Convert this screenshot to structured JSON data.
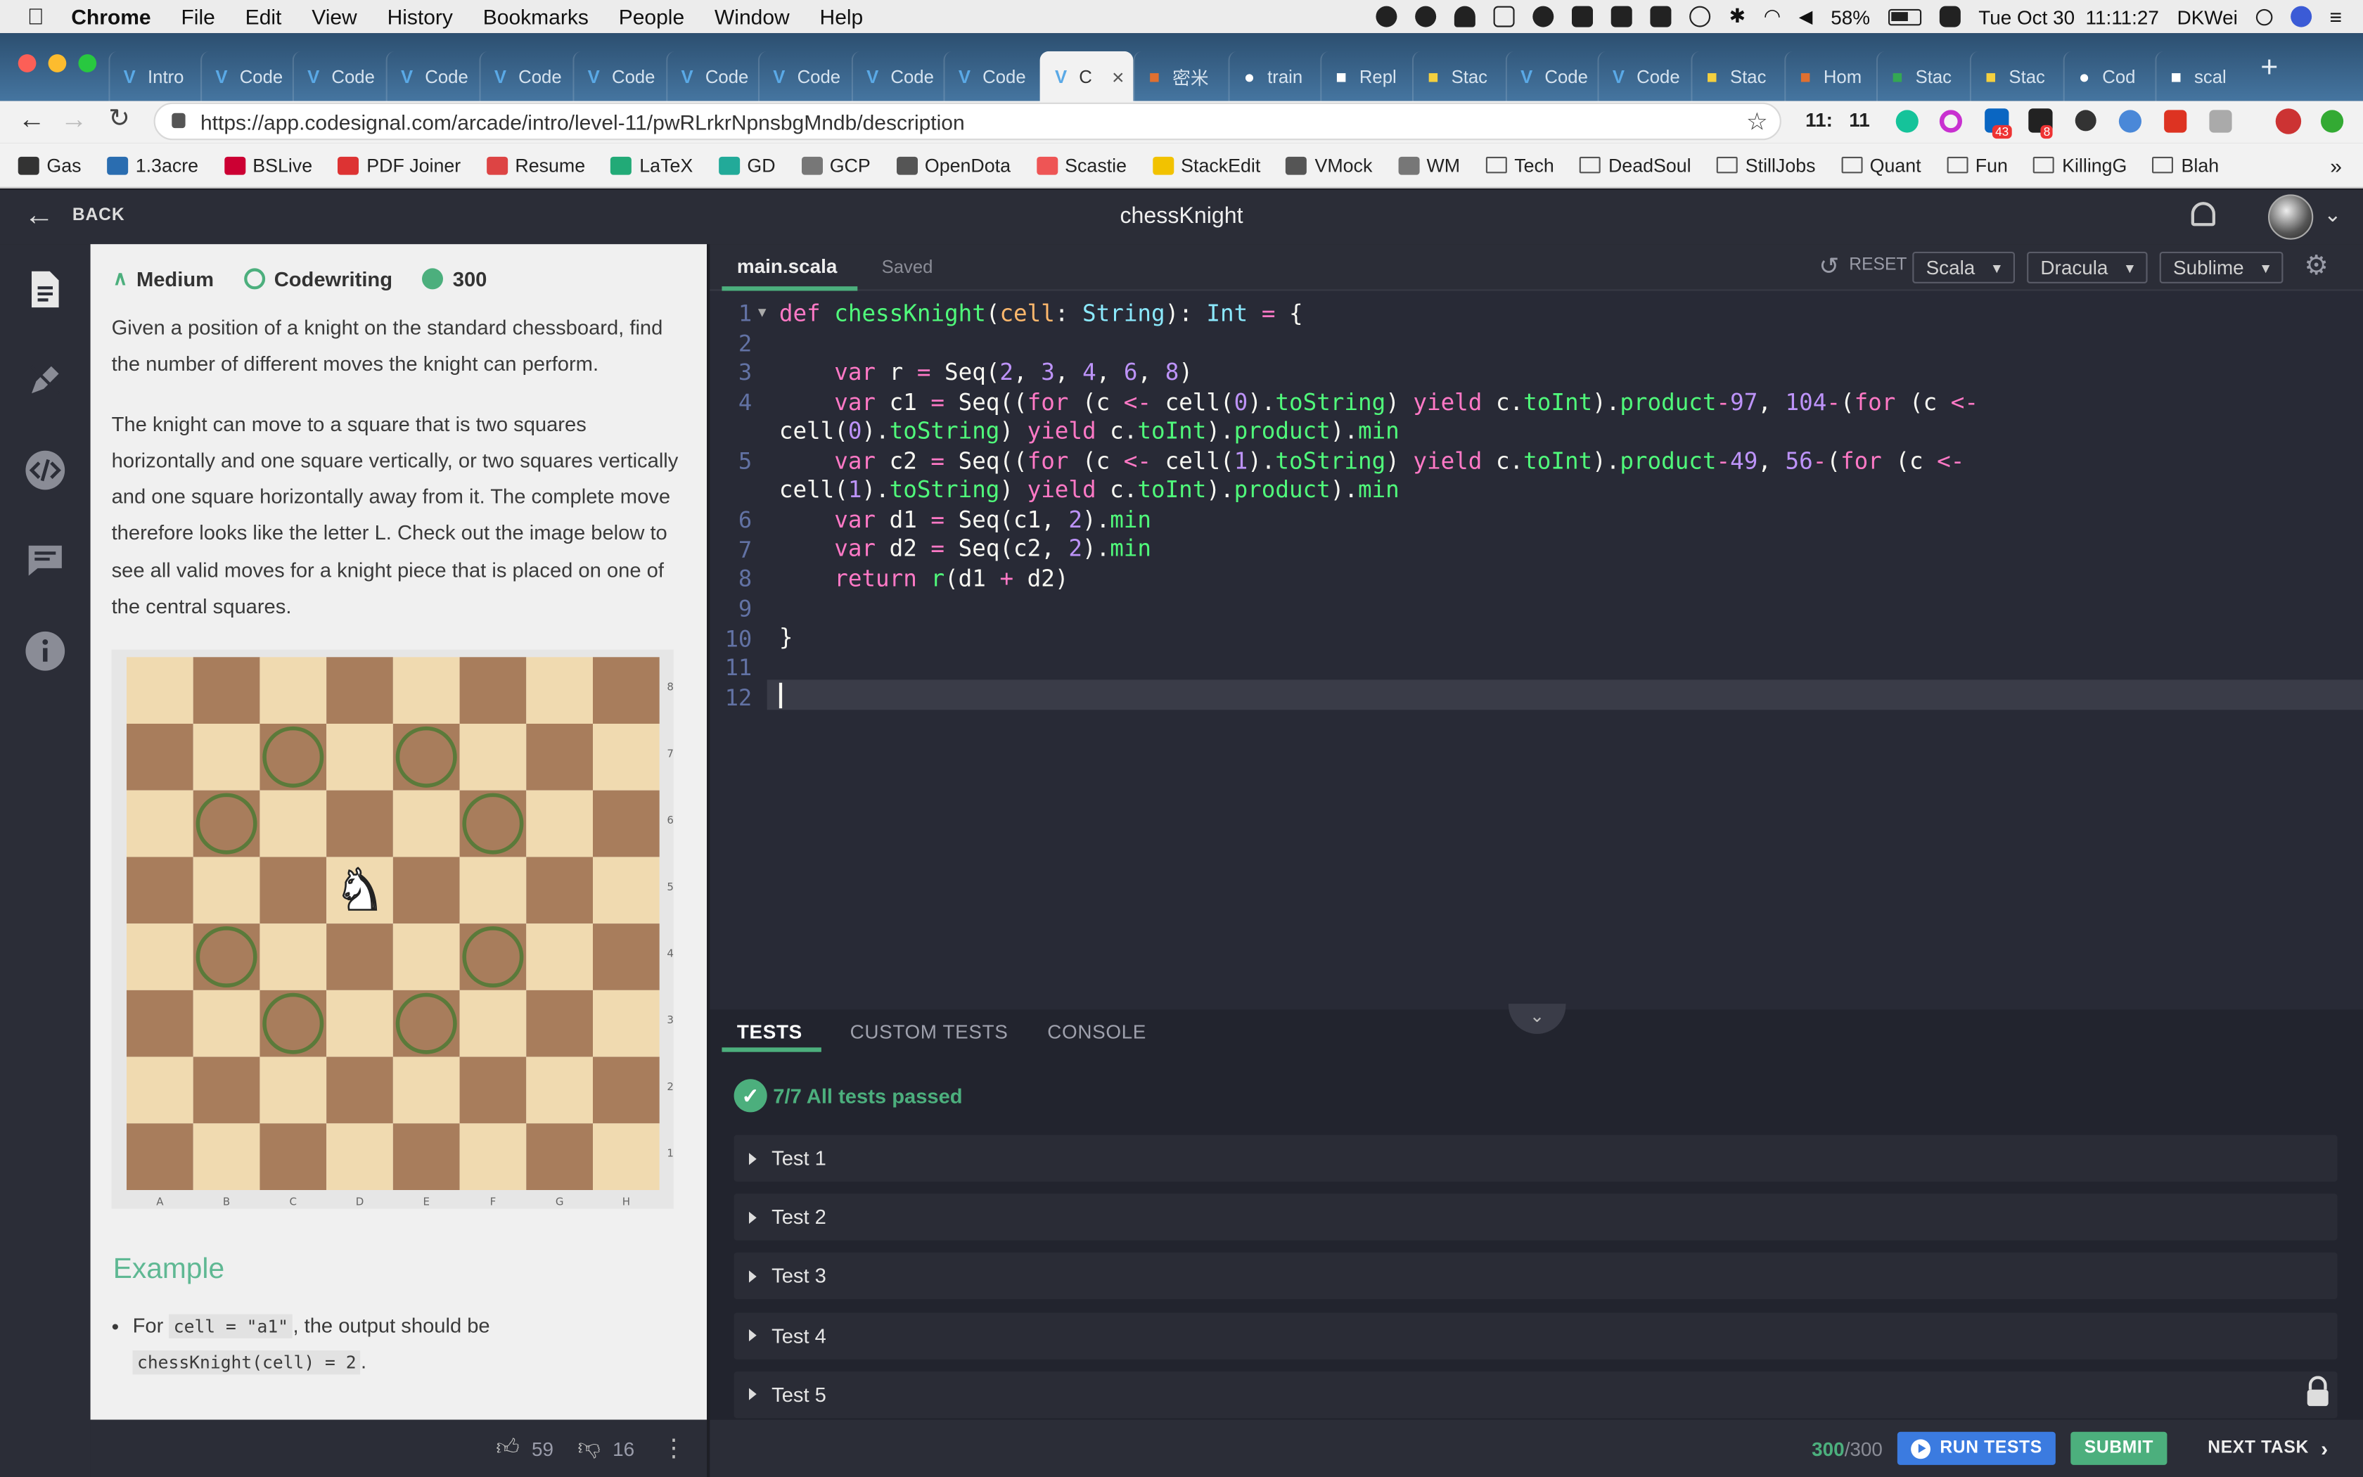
{
  "menubar": {
    "app": "Chrome",
    "items": [
      "File",
      "Edit",
      "View",
      "History",
      "Bookmarks",
      "People",
      "Window",
      "Help"
    ],
    "battery": "58%",
    "datetime": "Tue Oct 30  11:11:27",
    "user": "DKWei"
  },
  "tabs": [
    {
      "title": "Intro",
      "icon": "codesignal-icon"
    },
    {
      "title": "Code",
      "icon": "codesignal-icon"
    },
    {
      "title": "Code",
      "icon": "codesignal-icon"
    },
    {
      "title": "Code",
      "icon": "codesignal-icon"
    },
    {
      "title": "Code",
      "icon": "codesignal-icon"
    },
    {
      "title": "Code",
      "icon": "codesignal-icon"
    },
    {
      "title": "Code",
      "icon": "codesignal-icon"
    },
    {
      "title": "Code",
      "icon": "codesignal-icon"
    },
    {
      "title": "Code",
      "icon": "codesignal-icon"
    },
    {
      "title": "Code",
      "icon": "codesignal-icon"
    },
    {
      "title": "C",
      "icon": "codesignal-icon",
      "active": true
    },
    {
      "title": "密米",
      "icon": "book-icon"
    },
    {
      "title": "train",
      "icon": "github-icon"
    },
    {
      "title": "Repl",
      "icon": "repl-icon"
    },
    {
      "title": "Stac",
      "icon": "stack-icon"
    },
    {
      "title": "Code",
      "icon": "codesignal-icon"
    },
    {
      "title": "Code",
      "icon": "codesignal-icon"
    },
    {
      "title": "Stac",
      "icon": "stack-icon"
    },
    {
      "title": "Hom",
      "icon": "home-icon"
    },
    {
      "title": "Stac",
      "icon": "drive-icon"
    },
    {
      "title": "Stac",
      "icon": "stack-icon"
    },
    {
      "title": "Cod",
      "icon": "github-icon"
    },
    {
      "title": "scal",
      "icon": "google-icon"
    }
  ],
  "address": {
    "url": "https://app.codesignal.com/arcade/intro/level-11/pwRLrkrNpnsbgMndb/description",
    "counter1": "11:",
    "counter2": "11",
    "badge1": "43",
    "badge2": "8"
  },
  "bookmarks": [
    "Gas",
    "1.3acre",
    "BSLive",
    "PDF Joiner",
    "Resume",
    "LaTeX",
    "GD",
    "GCP",
    "OpenDota",
    "Scastie",
    "StackEdit",
    "VMock",
    "WM",
    "Tech",
    "DeadSoul",
    "StillJobs",
    "Quant",
    "Fun",
    "KillingG",
    "Blah"
  ],
  "header": {
    "back": "BACK",
    "title": "chessKnight"
  },
  "task": {
    "difficulty": "Medium",
    "type": "Codewriting",
    "points": "300",
    "p1": "Given a position of a knight on the standard chessboard, find the number of different moves the knight can perform.",
    "p2": "The knight can move to a square that is two squares horizontally and one square vertically, or two squares vertically and one square horizontally away from it. The complete move therefore looks like the letter L. Check out the image below to see all valid moves for a knight piece that is placed on one of the central squares.",
    "board": {
      "files": [
        "A",
        "B",
        "C",
        "D",
        "E",
        "F",
        "G",
        "H"
      ],
      "ranks": [
        "8",
        "7",
        "6",
        "5",
        "4",
        "3",
        "2",
        "1"
      ],
      "knight": "D5",
      "targets": [
        "C7",
        "E7",
        "B6",
        "F6",
        "B4",
        "F4",
        "C3",
        "E3"
      ]
    },
    "example_heading": "Example",
    "example_pre": "For ",
    "example_code1": "cell = \"a1\"",
    "example_mid": ", the output should be",
    "example_code2": "chessKnight(cell) = 2",
    "example_post": ".",
    "likes": "59",
    "dislikes": "16"
  },
  "editor": {
    "file": "main.scala",
    "status": "Saved",
    "reset": "RESET",
    "language": "Scala",
    "theme": "Dracula",
    "keymap": "Sublime",
    "line_numbers": [
      "1",
      "2",
      "3",
      "4",
      "",
      "5",
      "",
      "6",
      "7",
      "8",
      "9",
      "10",
      "11",
      "12"
    ]
  },
  "bottom": {
    "tabs": [
      "TESTS",
      "CUSTOM TESTS",
      "CONSOLE"
    ],
    "summary": "7/7 All tests passed",
    "tests": [
      "Test 1",
      "Test 2",
      "Test 3",
      "Test 4",
      "Test 5"
    ],
    "score": "300",
    "score_total": "/300",
    "run": "RUN TESTS",
    "submit": "SUBMIT",
    "next": "NEXT TASK"
  }
}
